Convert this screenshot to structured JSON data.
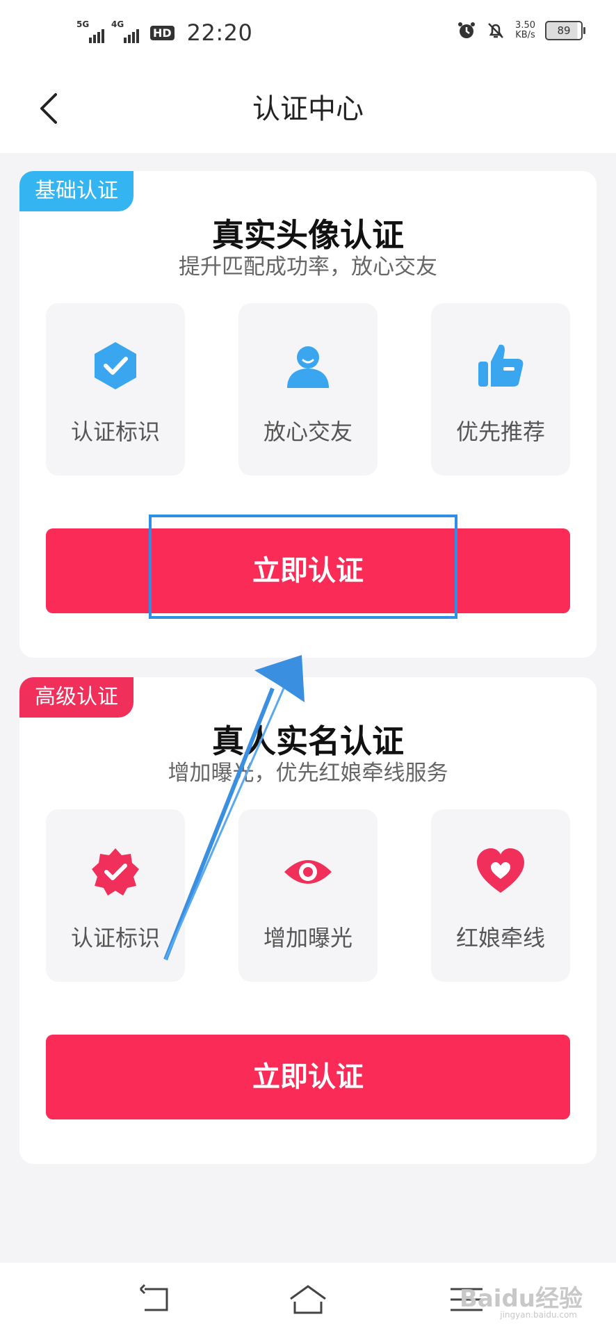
{
  "status_bar": {
    "network_1": "5G",
    "network_2": "4G",
    "hd": "HD",
    "time": "22:20",
    "speed_value": "3.50",
    "speed_unit": "KB/s",
    "battery": "89"
  },
  "header": {
    "title": "认证中心"
  },
  "basic": {
    "badge": "基础认证",
    "title": "真实头像认证",
    "subtitle": "提升匹配成功率，放心交友",
    "features": [
      {
        "label": "认证标识",
        "icon": "verified-shield-icon"
      },
      {
        "label": "放心交友",
        "icon": "person-icon"
      },
      {
        "label": "优先推荐",
        "icon": "thumbs-up-icon"
      }
    ],
    "button": "立即认证"
  },
  "advanced": {
    "badge": "高级认证",
    "title": "真人实名认证",
    "subtitle": "增加曝光，优先红娘牵线服务",
    "features": [
      {
        "label": "认证标识",
        "icon": "verified-badge-icon"
      },
      {
        "label": "增加曝光",
        "icon": "eye-icon"
      },
      {
        "label": "红娘牵线",
        "icon": "heart-icon"
      }
    ],
    "button": "立即认证"
  },
  "watermark": {
    "text": "Baidu经验",
    "url": "jingyan.baidu.com"
  },
  "colors": {
    "accent_red": "#fa2b56",
    "badge_blue": "#35b4f2",
    "badge_red": "#f0305a",
    "icon_blue": "#3aa6f0",
    "annotation_blue": "#2d8fe6"
  }
}
